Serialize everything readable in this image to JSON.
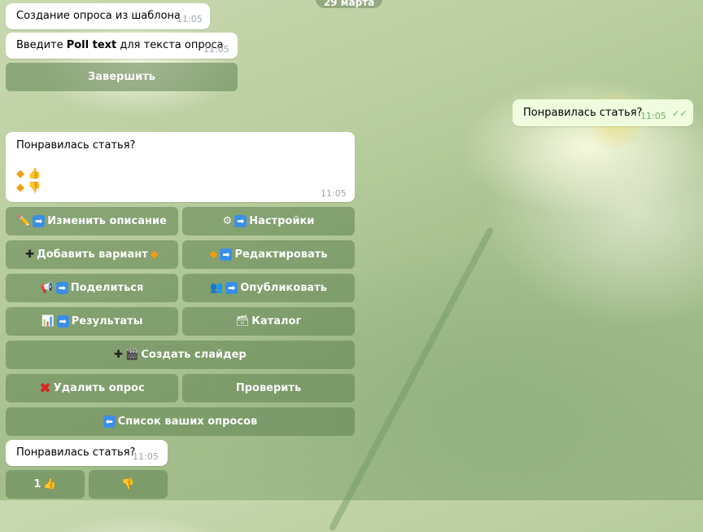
{
  "date_label": "29 марта",
  "messages": {
    "m1": {
      "text": "Создание опроса из шаблона",
      "time": "11:05"
    },
    "m2": {
      "text_before": "Введите ",
      "text_bold": "Poll text",
      "text_after": " для текста опроса",
      "time": "11:05"
    },
    "finish_button": "Завершить",
    "outgoing": {
      "text": "Понравилась статья?",
      "time": "11:05"
    },
    "poll": {
      "title": "Понравилась статья?",
      "option1": "👍",
      "option2": "👎",
      "time": "11:05"
    },
    "last": {
      "text": "Понравилась статья?",
      "time": "11:05"
    }
  },
  "keyboard": {
    "edit_description": "Изменить описание",
    "settings": "Настройки",
    "add_option": "Добавить вариант",
    "edit": "Редактировать",
    "share": "Поделиться",
    "publish": "Опубликовать",
    "results": "Результаты",
    "catalog": "Каталог",
    "create_slider": "Создать слайдер",
    "delete_poll": "Удалить опрос",
    "check": "Проверить",
    "your_polls": "Список ваших опросов"
  },
  "votes": {
    "like_count": "1",
    "like_icon": "👍",
    "dislike_icon": "👎"
  },
  "icons": {
    "pencil": "✏️",
    "arrow": "➡",
    "gear": "⚙",
    "plus": "✚",
    "diamond": "◆",
    "megaphone": "📢",
    "people": "👥",
    "chart": "📊",
    "box": "🗃",
    "clapper": "🎬",
    "cross": "✖",
    "back": "⬅"
  }
}
